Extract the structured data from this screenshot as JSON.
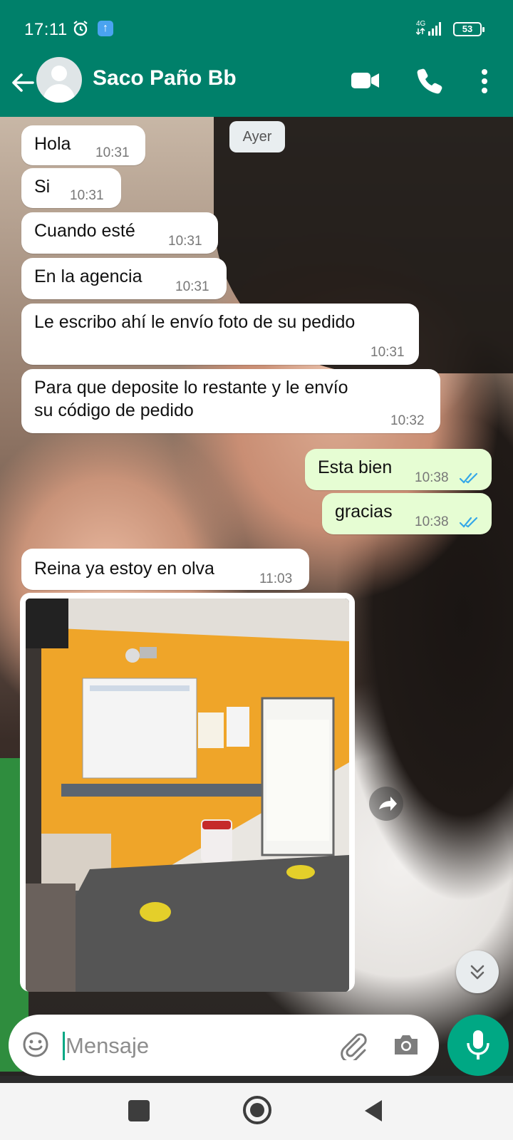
{
  "status_bar": {
    "time": "17:11",
    "network": "4G",
    "battery": "53"
  },
  "header": {
    "contact_name": "Saco Paño Bb"
  },
  "chat": {
    "date_chip": "Ayer",
    "messages": [
      {
        "direction": "in",
        "text": "Hola",
        "time": "10:31"
      },
      {
        "direction": "in",
        "text": "Si",
        "time": "10:31"
      },
      {
        "direction": "in",
        "text": "Cuando esté",
        "time": "10:31"
      },
      {
        "direction": "in",
        "text": "En la agencia",
        "time": "10:31"
      },
      {
        "direction": "in",
        "text": "Le escribo ahí le envío foto de su pedido",
        "time": "10:31"
      },
      {
        "direction": "in",
        "text_line1": "Para que deposite lo restante  y le envío",
        "text_line2": "su código de pedido",
        "time": "10:32"
      },
      {
        "direction": "out",
        "text": "Esta bien",
        "time": "10:38",
        "status": "read"
      },
      {
        "direction": "out",
        "text": "gracias",
        "time": "10:38",
        "status": "read"
      },
      {
        "direction": "in",
        "text": "Reina ya estoy en olva",
        "time": "11:03"
      }
    ]
  },
  "input": {
    "placeholder": "Mensaje"
  },
  "colors": {
    "header": "#00806a",
    "accent": "#00a884",
    "outgoing_bubble": "#e6fdd3",
    "read_ticks": "#34a7e8"
  }
}
